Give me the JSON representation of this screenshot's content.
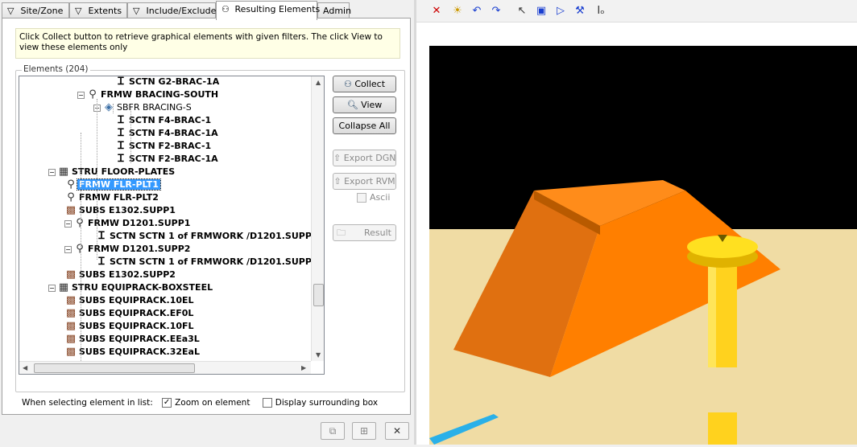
{
  "tabs": [
    {
      "label": "Site/Zone",
      "icon": "funnel-icon"
    },
    {
      "label": "Extents",
      "icon": "funnel-icon"
    },
    {
      "label": "Include/Exclude",
      "icon": "funnel-icon"
    },
    {
      "label": "Resulting Elements",
      "icon": "binoculars-icon"
    },
    {
      "label": "Admin",
      "icon": ""
    }
  ],
  "hint": "Click Collect button to retrieve graphical elements with given filters. The click View to view these elements only",
  "elements_group_label": "Elements (204)",
  "tree": [
    {
      "label": "SCTN G2-BRAC-1A",
      "icon": "beam-icon",
      "expander": ""
    },
    {
      "label": "FRMW BRACING-SOUTH",
      "icon": "framework-icon",
      "expander": "−"
    },
    {
      "label": "SBFR BRACING-S",
      "icon": "cube-icon",
      "expander": "−"
    },
    {
      "label": "SCTN F4-BRAC-1",
      "icon": "beam-icon",
      "expander": ""
    },
    {
      "label": "SCTN F4-BRAC-1A",
      "icon": "beam-icon",
      "expander": ""
    },
    {
      "label": "SCTN F2-BRAC-1",
      "icon": "beam-icon",
      "expander": ""
    },
    {
      "label": "SCTN F2-BRAC-1A",
      "icon": "beam-icon",
      "expander": ""
    },
    {
      "label": "STRU FLOOR-PLATES",
      "icon": "structure-icon",
      "expander": "−"
    },
    {
      "label": "FRMW FLR-PLT1",
      "icon": "framework-icon",
      "expander": ""
    },
    {
      "label": "FRMW FLR-PLT2",
      "icon": "framework-icon",
      "expander": ""
    },
    {
      "label": "SUBS E1302.SUPP1",
      "icon": "subs-icon",
      "expander": ""
    },
    {
      "label": "FRMW D1201.SUPP1",
      "icon": "framework-icon",
      "expander": "−"
    },
    {
      "label": "SCTN SCTN 1 of FRMWORK /D1201.SUPP1",
      "icon": "beam-icon",
      "expander": ""
    },
    {
      "label": "FRMW D1201.SUPP2",
      "icon": "framework-icon",
      "expander": "−"
    },
    {
      "label": "SCTN SCTN 1 of FRMWORK /D1201.SUPP2",
      "icon": "beam-icon",
      "expander": ""
    },
    {
      "label": "SUBS E1302.SUPP2",
      "icon": "subs-icon",
      "expander": ""
    },
    {
      "label": "STRU EQUIPRACK-BOXSTEEL",
      "icon": "structure-icon",
      "expander": "−"
    },
    {
      "label": "SUBS EQUIPRACK.10EL",
      "icon": "subs-icon",
      "expander": ""
    },
    {
      "label": "SUBS EQUIPRACK.EF0L",
      "icon": "subs-icon",
      "expander": ""
    },
    {
      "label": "SUBS EQUIPRACK.10FL",
      "icon": "subs-icon",
      "expander": ""
    },
    {
      "label": "SUBS EQUIPRACK.EEa3L",
      "icon": "subs-icon",
      "expander": ""
    },
    {
      "label": "SUBS EQUIPRACK.32EaL",
      "icon": "subs-icon",
      "expander": ""
    }
  ],
  "buttons": {
    "collect": "Collect",
    "view": "View",
    "collapse_all": "Collapse All",
    "export_dgn": "Export DGN",
    "export_rvm": "Export RVM",
    "ascii": "Ascii",
    "result": "Result"
  },
  "options": {
    "prefix": "When selecting element in list:",
    "zoom_on_element": "Zoom on element",
    "zoom_checked": true,
    "display_box": "Display surrounding box",
    "display_box_checked": false
  },
  "colors": {
    "selection": "#3399ff",
    "viewport_bg": "#000000",
    "floor": "#f0dca4",
    "orange_solid": "#ff8c1a",
    "yellow_post": "#ffd21e"
  }
}
